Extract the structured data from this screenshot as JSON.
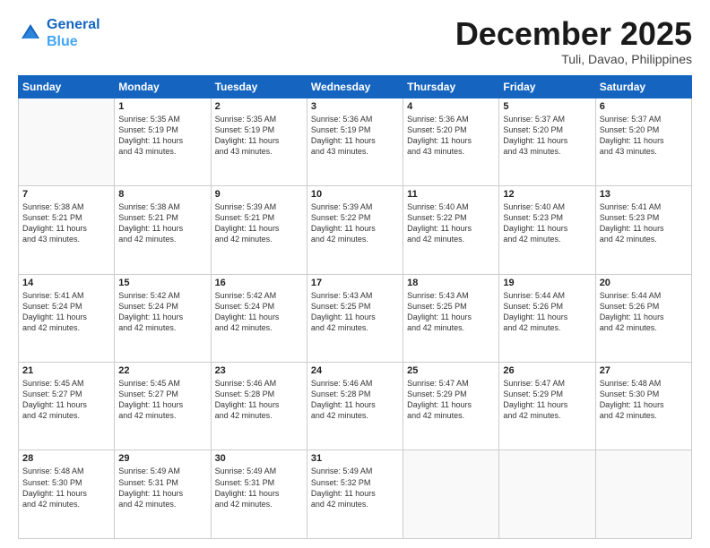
{
  "logo": {
    "line1": "General",
    "line2": "Blue"
  },
  "title": "December 2025",
  "location": "Tuli, Davao, Philippines",
  "weekdays": [
    "Sunday",
    "Monday",
    "Tuesday",
    "Wednesday",
    "Thursday",
    "Friday",
    "Saturday"
  ],
  "weeks": [
    [
      {
        "day": "",
        "info": ""
      },
      {
        "day": "1",
        "info": "Sunrise: 5:35 AM\nSunset: 5:19 PM\nDaylight: 11 hours\nand 43 minutes."
      },
      {
        "day": "2",
        "info": "Sunrise: 5:35 AM\nSunset: 5:19 PM\nDaylight: 11 hours\nand 43 minutes."
      },
      {
        "day": "3",
        "info": "Sunrise: 5:36 AM\nSunset: 5:19 PM\nDaylight: 11 hours\nand 43 minutes."
      },
      {
        "day": "4",
        "info": "Sunrise: 5:36 AM\nSunset: 5:20 PM\nDaylight: 11 hours\nand 43 minutes."
      },
      {
        "day": "5",
        "info": "Sunrise: 5:37 AM\nSunset: 5:20 PM\nDaylight: 11 hours\nand 43 minutes."
      },
      {
        "day": "6",
        "info": "Sunrise: 5:37 AM\nSunset: 5:20 PM\nDaylight: 11 hours\nand 43 minutes."
      }
    ],
    [
      {
        "day": "7",
        "info": "Sunrise: 5:38 AM\nSunset: 5:21 PM\nDaylight: 11 hours\nand 43 minutes."
      },
      {
        "day": "8",
        "info": "Sunrise: 5:38 AM\nSunset: 5:21 PM\nDaylight: 11 hours\nand 42 minutes."
      },
      {
        "day": "9",
        "info": "Sunrise: 5:39 AM\nSunset: 5:21 PM\nDaylight: 11 hours\nand 42 minutes."
      },
      {
        "day": "10",
        "info": "Sunrise: 5:39 AM\nSunset: 5:22 PM\nDaylight: 11 hours\nand 42 minutes."
      },
      {
        "day": "11",
        "info": "Sunrise: 5:40 AM\nSunset: 5:22 PM\nDaylight: 11 hours\nand 42 minutes."
      },
      {
        "day": "12",
        "info": "Sunrise: 5:40 AM\nSunset: 5:23 PM\nDaylight: 11 hours\nand 42 minutes."
      },
      {
        "day": "13",
        "info": "Sunrise: 5:41 AM\nSunset: 5:23 PM\nDaylight: 11 hours\nand 42 minutes."
      }
    ],
    [
      {
        "day": "14",
        "info": "Sunrise: 5:41 AM\nSunset: 5:24 PM\nDaylight: 11 hours\nand 42 minutes."
      },
      {
        "day": "15",
        "info": "Sunrise: 5:42 AM\nSunset: 5:24 PM\nDaylight: 11 hours\nand 42 minutes."
      },
      {
        "day": "16",
        "info": "Sunrise: 5:42 AM\nSunset: 5:24 PM\nDaylight: 11 hours\nand 42 minutes."
      },
      {
        "day": "17",
        "info": "Sunrise: 5:43 AM\nSunset: 5:25 PM\nDaylight: 11 hours\nand 42 minutes."
      },
      {
        "day": "18",
        "info": "Sunrise: 5:43 AM\nSunset: 5:25 PM\nDaylight: 11 hours\nand 42 minutes."
      },
      {
        "day": "19",
        "info": "Sunrise: 5:44 AM\nSunset: 5:26 PM\nDaylight: 11 hours\nand 42 minutes."
      },
      {
        "day": "20",
        "info": "Sunrise: 5:44 AM\nSunset: 5:26 PM\nDaylight: 11 hours\nand 42 minutes."
      }
    ],
    [
      {
        "day": "21",
        "info": "Sunrise: 5:45 AM\nSunset: 5:27 PM\nDaylight: 11 hours\nand 42 minutes."
      },
      {
        "day": "22",
        "info": "Sunrise: 5:45 AM\nSunset: 5:27 PM\nDaylight: 11 hours\nand 42 minutes."
      },
      {
        "day": "23",
        "info": "Sunrise: 5:46 AM\nSunset: 5:28 PM\nDaylight: 11 hours\nand 42 minutes."
      },
      {
        "day": "24",
        "info": "Sunrise: 5:46 AM\nSunset: 5:28 PM\nDaylight: 11 hours\nand 42 minutes."
      },
      {
        "day": "25",
        "info": "Sunrise: 5:47 AM\nSunset: 5:29 PM\nDaylight: 11 hours\nand 42 minutes."
      },
      {
        "day": "26",
        "info": "Sunrise: 5:47 AM\nSunset: 5:29 PM\nDaylight: 11 hours\nand 42 minutes."
      },
      {
        "day": "27",
        "info": "Sunrise: 5:48 AM\nSunset: 5:30 PM\nDaylight: 11 hours\nand 42 minutes."
      }
    ],
    [
      {
        "day": "28",
        "info": "Sunrise: 5:48 AM\nSunset: 5:30 PM\nDaylight: 11 hours\nand 42 minutes."
      },
      {
        "day": "29",
        "info": "Sunrise: 5:49 AM\nSunset: 5:31 PM\nDaylight: 11 hours\nand 42 minutes."
      },
      {
        "day": "30",
        "info": "Sunrise: 5:49 AM\nSunset: 5:31 PM\nDaylight: 11 hours\nand 42 minutes."
      },
      {
        "day": "31",
        "info": "Sunrise: 5:49 AM\nSunset: 5:32 PM\nDaylight: 11 hours\nand 42 minutes."
      },
      {
        "day": "",
        "info": ""
      },
      {
        "day": "",
        "info": ""
      },
      {
        "day": "",
        "info": ""
      }
    ]
  ]
}
